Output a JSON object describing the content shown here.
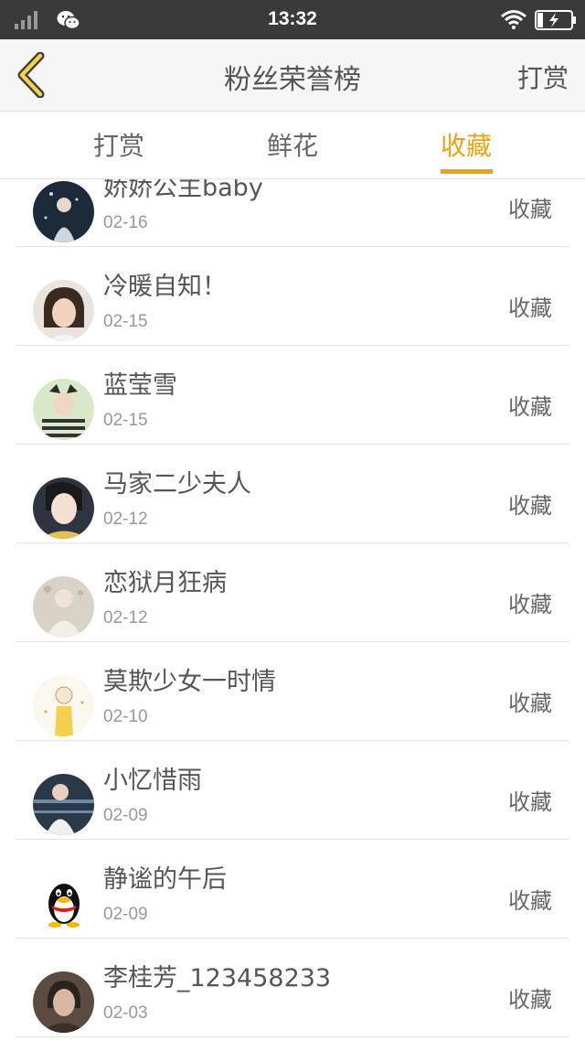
{
  "status": {
    "time": "13:32"
  },
  "nav": {
    "title": "粉丝荣誉榜",
    "right": "打赏"
  },
  "tabs": [
    {
      "label": "打赏",
      "active": false
    },
    {
      "label": "鲜花",
      "active": false
    },
    {
      "label": "收藏",
      "active": true
    }
  ],
  "accent": "#e8a317",
  "list": [
    {
      "name": "娇娇公主baby",
      "date": "02-16",
      "type": "收藏",
      "avatar": "dark-girl"
    },
    {
      "name": "冷暖自知！",
      "date": "02-15",
      "type": "收藏",
      "avatar": "girl-face"
    },
    {
      "name": "蓝莹雪",
      "date": "02-15",
      "type": "收藏",
      "avatar": "striped-girl"
    },
    {
      "name": "马家二少夫人",
      "date": "02-12",
      "type": "收藏",
      "avatar": "profile-girl"
    },
    {
      "name": "恋狱月狂病",
      "date": "02-12",
      "type": "收藏",
      "avatar": "soft-photo"
    },
    {
      "name": "莫欺少女一时情",
      "date": "02-10",
      "type": "收藏",
      "avatar": "cartoon"
    },
    {
      "name": "小忆惜雨",
      "date": "02-09",
      "type": "收藏",
      "avatar": "boy-photo"
    },
    {
      "name": "静谧的午后",
      "date": "02-09",
      "type": "收藏",
      "avatar": "qq-penguin"
    },
    {
      "name": "李桂芳_123458233",
      "date": "02-03",
      "type": "收藏",
      "avatar": "elder-photo"
    }
  ]
}
